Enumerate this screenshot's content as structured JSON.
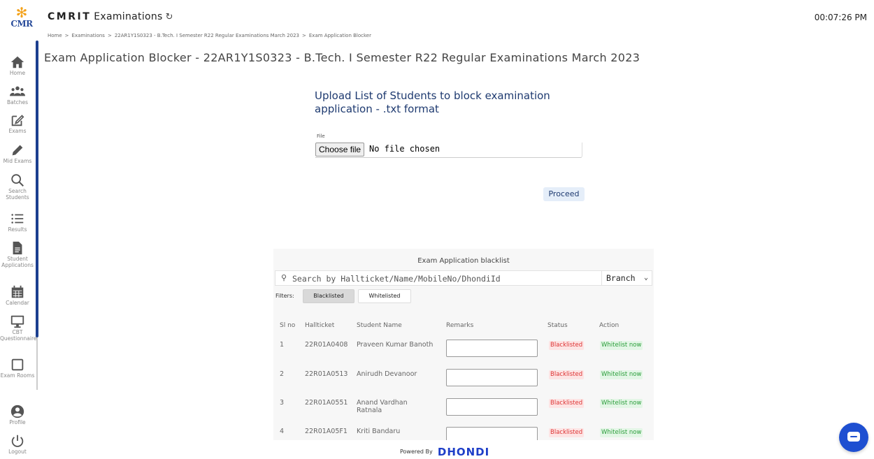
{
  "app": {
    "brand": "CMRIT",
    "subtitle": "Examinations",
    "clock": "00:07:26 PM",
    "logo_text": "CMR"
  },
  "breadcrumb": [
    "Home",
    "Examinations",
    "22AR1Y1S0323 - B.Tech. I Semester R22 Regular Examinations March 2023",
    "Exam Application Blocker"
  ],
  "page_title": "Exam Application Blocker - 22AR1Y1S0323 - B.Tech. I Semester R22 Regular Examinations March 2023",
  "sidebar": {
    "items": [
      {
        "label": "Home",
        "icon": "home-icon"
      },
      {
        "label": "Batches",
        "icon": "users-icon"
      },
      {
        "label": "Exams",
        "icon": "edit-icon"
      },
      {
        "label": "Mid Exams",
        "icon": "pencil-icon"
      },
      {
        "label": "Search Students",
        "icon": "search-icon"
      },
      {
        "label": "Results",
        "icon": "list-icon"
      },
      {
        "label": "Student Applications",
        "icon": "file-icon"
      },
      {
        "label": "Calendar",
        "icon": "calendar-icon"
      },
      {
        "label": "CBT Questionnaire",
        "icon": "monitor-icon"
      },
      {
        "label": "Exam Rooms",
        "icon": "square-icon"
      },
      {
        "label": "Profile",
        "icon": "user-circle-icon"
      },
      {
        "label": "Logout",
        "icon": "power-icon"
      }
    ]
  },
  "upload": {
    "heading": "Upload List of Students to block examination application - .txt format",
    "file_label": "File",
    "choose_label": "Choose file",
    "no_file_text": "No file chosen",
    "proceed_label": "Proceed"
  },
  "blacklist": {
    "title": "Exam Application blacklist",
    "search_placeholder": "Search by Hallticket/Name/MobileNo/DhondiId",
    "branch_label": "Branch",
    "filters_label": "Filters:",
    "filter_blacklisted": "Blacklisted",
    "filter_whitelisted": "Whitelisted",
    "columns": [
      "Sl no",
      "Hallticket",
      "Student Name",
      "Remarks",
      "Status",
      "Action"
    ],
    "rows": [
      {
        "sl": "1",
        "hallticket": "22R01A0408",
        "name": "Praveen Kumar Banoth",
        "status": "Blacklisted",
        "action": "Whitelist now"
      },
      {
        "sl": "2",
        "hallticket": "22R01A0513",
        "name": "Anirudh Devanoor",
        "status": "Blacklisted",
        "action": "Whitelist now"
      },
      {
        "sl": "3",
        "hallticket": "22R01A0551",
        "name": "Anand Vardhan Ratnala",
        "status": "Blacklisted",
        "action": "Whitelist now"
      },
      {
        "sl": "4",
        "hallticket": "22R01A05F1",
        "name": "Kriti Bandaru",
        "status": "Blacklisted",
        "action": "Whitelist now"
      }
    ]
  },
  "footer": {
    "powered_by": "Powered By",
    "brand": "DHONDI"
  }
}
